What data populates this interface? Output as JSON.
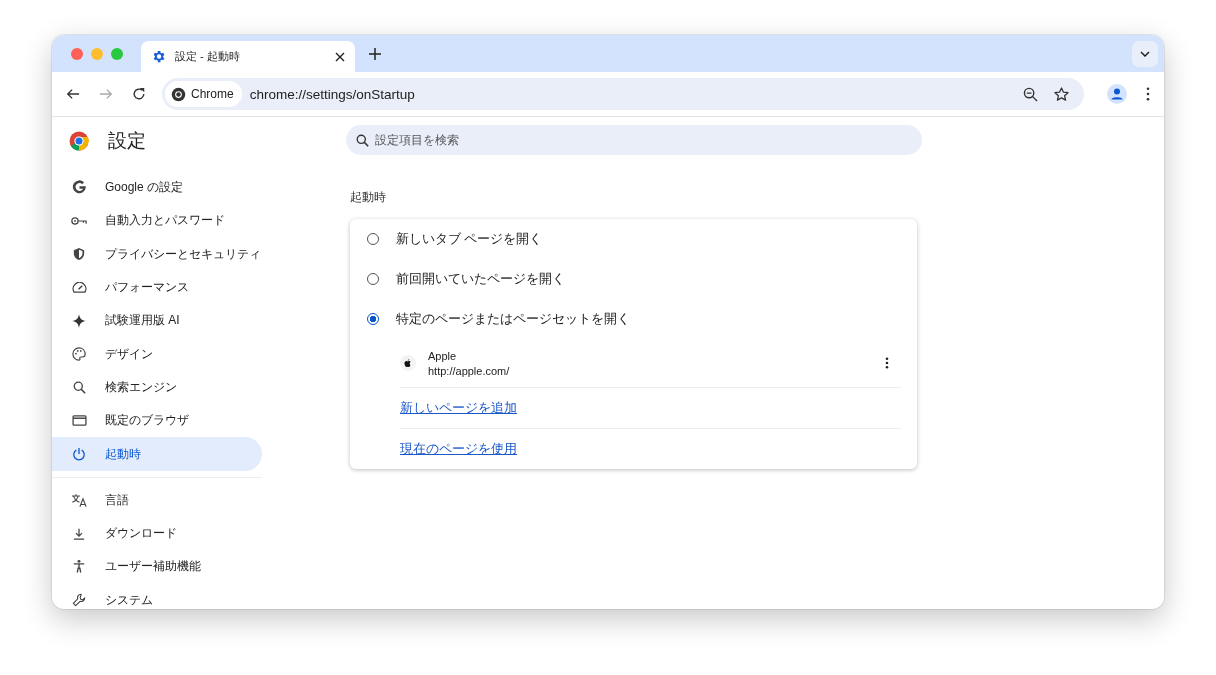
{
  "tab": {
    "title": "設定 - 起動時",
    "selected": true
  },
  "address": {
    "chip": "Chrome",
    "url": "chrome://settings/onStartup"
  },
  "sidebar": {
    "title": "設定",
    "groups": [
      [
        {
          "label": "Google の設定",
          "selected": false
        },
        {
          "label": "自動入力とパスワード",
          "selected": false
        },
        {
          "label": "プライバシーとセキュリティ",
          "selected": false
        },
        {
          "label": "パフォーマンス",
          "selected": false
        },
        {
          "label": "試験運用版 AI",
          "selected": false
        },
        {
          "label": "デザイン",
          "selected": false
        },
        {
          "label": "検索エンジン",
          "selected": false
        },
        {
          "label": "既定のブラウザ",
          "selected": false
        },
        {
          "label": "起動時",
          "selected": true
        }
      ],
      [
        {
          "label": "言語",
          "selected": false
        },
        {
          "label": "ダウンロード",
          "selected": false
        },
        {
          "label": "ユーザー補助機能",
          "selected": false
        },
        {
          "label": "システム",
          "selected": false
        }
      ]
    ]
  },
  "search": {
    "placeholder": "設定項目を検索"
  },
  "startup": {
    "heading": "起動時",
    "options": [
      {
        "label": "新しいタブ ページを開く",
        "selected": false
      },
      {
        "label": "前回開いていたページを開く",
        "selected": false
      },
      {
        "label": "特定のページまたはページセットを開く",
        "selected": true
      }
    ],
    "pages": [
      {
        "name": "Apple",
        "url": "http://apple.com/"
      }
    ],
    "links": [
      "新しいページを追加",
      "現在のページを使用"
    ]
  }
}
